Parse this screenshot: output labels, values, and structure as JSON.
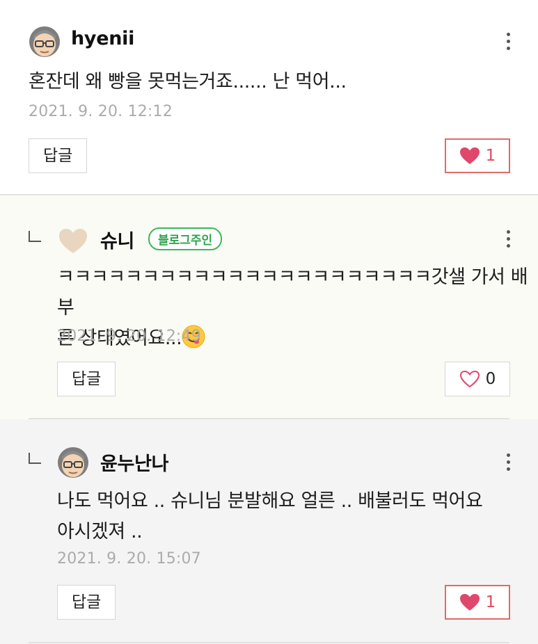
{
  "colors": {
    "owner_badge": "#3cb75a",
    "like_active": "#e04b5a",
    "date": "#ababab"
  },
  "comments": [
    {
      "nickname": "hyenii",
      "avatar": "elder-avatar-icon",
      "text_lines": [
        "혼잔데 왜 빵을 못먹는거죠...... 난 먹어..."
      ],
      "date": "2021. 9. 20. 12:12",
      "reply_label": "답글",
      "like_count": "1",
      "liked": true
    },
    {
      "nickname": "슈니",
      "avatar": "heart-avatar-icon",
      "badge": "블로그주인",
      "text_lines": [
        "ㅋㅋㅋㅋㅋㅋㅋㅋㅋㅋㅋㅋㅋㅋㅋㅋㅋㅋㅋㅋㅋㅋ갓샐 가서 배부",
        "른 상태였어요..."
      ],
      "emoji": "yum-face-emoji",
      "date": "2021. 9. 20. 12:49",
      "reply_label": "답글",
      "like_count": "0",
      "liked": false
    },
    {
      "nickname": "윤누난나",
      "avatar": "elder-avatar-icon",
      "text_lines": [
        "나도 먹어요 .. 슈니님 분발해요 얼른 .. 배불러도 먹어요",
        "아시겠져 .."
      ],
      "date": "2021. 9. 20. 15:07",
      "reply_label": "답글",
      "like_count": "1",
      "liked": true
    }
  ]
}
